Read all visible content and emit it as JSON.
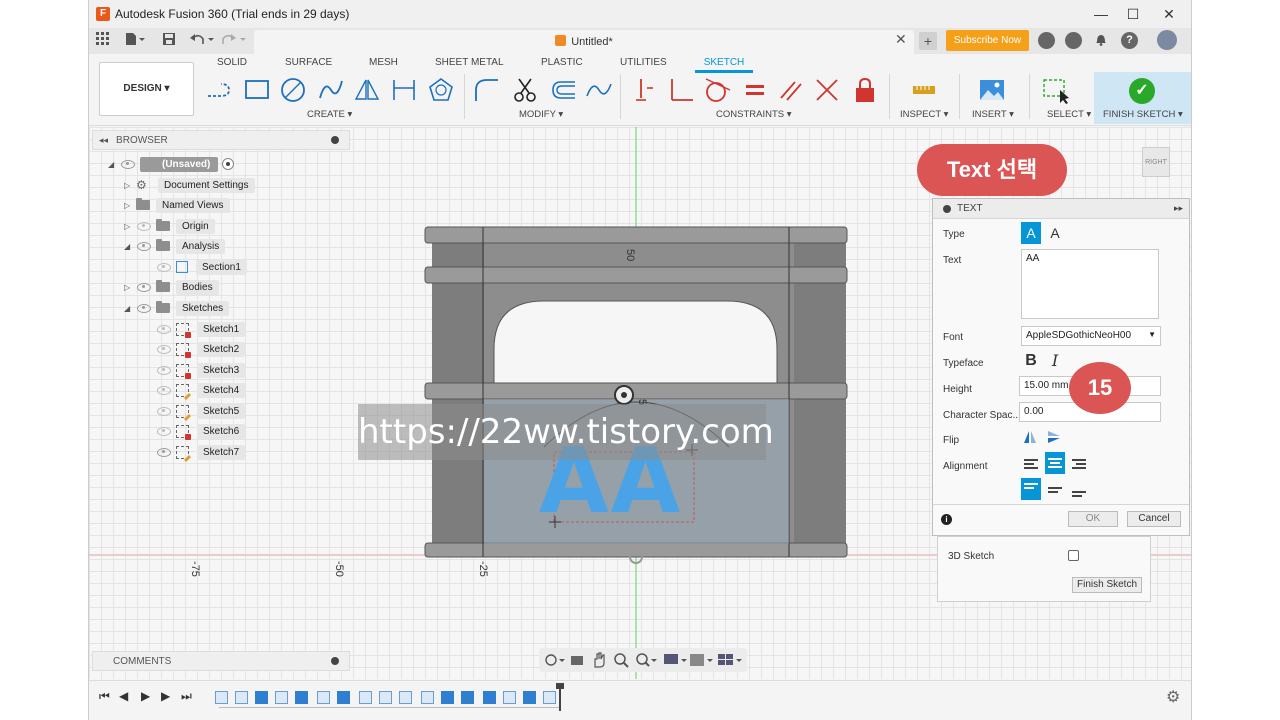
{
  "app": {
    "title": "Autodesk Fusion 360 (Trial ends in 29 days)",
    "icon_letter": "F",
    "doc_tab_title": "Untitled*",
    "subscribe_label": "Subscribe Now",
    "win_controls": [
      "—",
      "☐",
      "✕"
    ]
  },
  "toolbar": {
    "design_label": "DESIGN ▾",
    "workspace_tabs": [
      "SOLID",
      "SURFACE",
      "MESH",
      "SHEET METAL",
      "PLASTIC",
      "UTILITIES",
      "SKETCH"
    ],
    "active_tab": "SKETCH",
    "groups": {
      "create": "CREATE ▾",
      "modify": "MODIFY ▾",
      "constraints": "CONSTRAINTS ▾",
      "inspect": "INSPECT ▾",
      "insert": "INSERT ▾",
      "select": "SELECT ▾",
      "finish_sketch": "FINISH SKETCH ▾"
    }
  },
  "browser": {
    "header": "BROWSER",
    "root": "(Unsaved)",
    "items": [
      {
        "label": "Document Settings"
      },
      {
        "label": "Named Views"
      },
      {
        "label": "Origin"
      },
      {
        "label": "Analysis"
      },
      {
        "label": "Section1"
      },
      {
        "label": "Bodies"
      },
      {
        "label": "Sketches"
      },
      {
        "label": "Sketch1"
      },
      {
        "label": "Sketch2"
      },
      {
        "label": "Sketch3"
      },
      {
        "label": "Sketch4"
      },
      {
        "label": "Sketch5"
      },
      {
        "label": "Sketch6"
      },
      {
        "label": "Sketch7"
      }
    ]
  },
  "comments": {
    "header": "COMMENTS"
  },
  "viewcube": {
    "face": "RIGHT"
  },
  "callouts": {
    "text_select": "Text 선택",
    "step": "15"
  },
  "text_dialog": {
    "title": "TEXT",
    "type_label": "Type",
    "text_label": "Text",
    "text_value": "AA",
    "font_label": "Font",
    "font_value": "AppleSDGothicNeoH00",
    "typeface_label": "Typeface",
    "bold_glyph": "B",
    "italic_glyph": "I",
    "height_label": "Height",
    "height_value": "15.00 mm",
    "spacing_label": "Character Spac...",
    "spacing_value": "0.00",
    "flip_label": "Flip",
    "alignment_label": "Alignment",
    "ok_label": "OK",
    "cancel_label": "Cancel"
  },
  "lower_panel": {
    "sketch3d_label": "3D Sketch",
    "finish_label": "Finish Sketch"
  },
  "canvas": {
    "axis_ticks": [
      "-75",
      "-50",
      "-25"
    ],
    "dim_top": "50",
    "dim_circle": "5",
    "sketch_text": "AA",
    "watermark": "https://22ww.tistory.com"
  }
}
